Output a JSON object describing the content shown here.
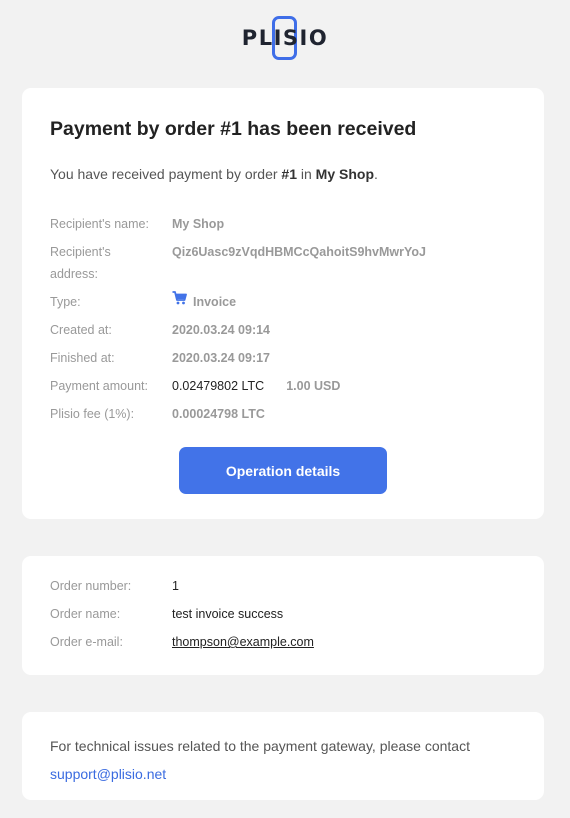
{
  "logo": {
    "text": "PLISIO"
  },
  "payment": {
    "title": "Payment by order #1 has been received",
    "intro_prefix": "You have received payment by order ",
    "intro_order": "#1",
    "intro_mid": " in ",
    "intro_shop": "My Shop",
    "intro_suffix": ".",
    "rows": [
      {
        "label": "Recipient's name:",
        "value": "My Shop"
      },
      {
        "label": "Recipient's address:",
        "value": "Qiz6Uasc9zVqdHBMCcQahoitS9hvMwrYoJ"
      },
      {
        "label": "Type:",
        "value": "Invoice",
        "icon": "cart-icon"
      },
      {
        "label": "Created at:",
        "value": "2020.03.24 09:14"
      },
      {
        "label": "Finished at:",
        "value": "2020.03.24 09:17"
      },
      {
        "label": "Payment amount:",
        "value": "0.02479802 LTC",
        "value_secondary": "1.00 USD"
      },
      {
        "label": "Plisio fee (1%):",
        "value": "0.00024798 LTC"
      }
    ],
    "button_label": "Operation details"
  },
  "order": {
    "rows": [
      {
        "label": "Order number:",
        "value": "1"
      },
      {
        "label": "Order name:",
        "value": "test invoice success"
      },
      {
        "label": "Order e-mail:",
        "value": "thompson@example.com"
      }
    ]
  },
  "support": {
    "text": "For technical issues related to the payment gateway, please contact",
    "email": "support@plisio.net"
  },
  "colors": {
    "accent": "#4273e8",
    "background": "#f2f2f2",
    "card": "#ffffff"
  }
}
